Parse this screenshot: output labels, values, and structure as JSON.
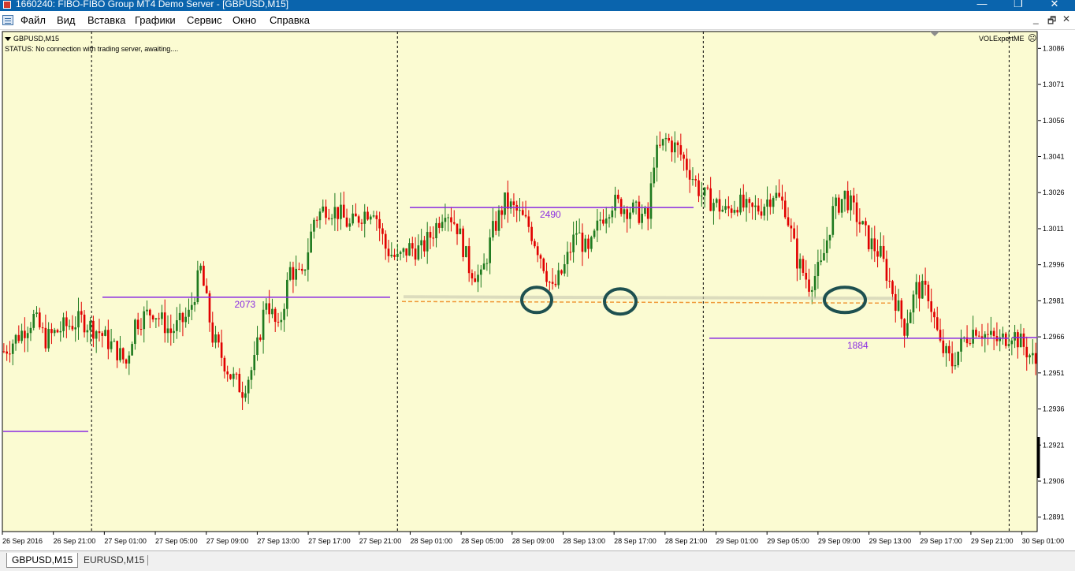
{
  "window": {
    "title": "1660240: FIBO-FIBO Group MT4 Demo Server - [GBPUSD,M15]",
    "controls": {
      "minimize": "—",
      "maximize": "❐",
      "close": "✕"
    }
  },
  "menu": {
    "items": [
      "Файл",
      "Вид",
      "Вставка",
      "Графики",
      "Сервис",
      "Окно",
      "Справка"
    ],
    "mdi": {
      "minimize": "_",
      "restore": "🗗",
      "close": "✕"
    }
  },
  "chart": {
    "symbol_label": "GBPUSD,M15",
    "status_text": "STATUS:    No connection with trading server, awaiting....",
    "expert_label": "VOLExpertME",
    "expert_icon": "smiley-face-icon",
    "colors": {
      "background": "#fbfbd2",
      "bull": "#1f7a1f",
      "bear": "#e10000",
      "level_line": "#8a2be2",
      "support_line": "#f09a3a",
      "marker": "#1e5050"
    }
  },
  "levels": [
    {
      "label": "2073",
      "price": 1.29825
    },
    {
      "label": "2490",
      "price": 1.30198
    },
    {
      "label": "1884",
      "price": 1.29654
    }
  ],
  "chart_data": {
    "type": "candlestick",
    "symbol": "GBPUSD",
    "timeframe": "M15",
    "y_ticks": [
      "1.3086",
      "1.3071",
      "1.3056",
      "1.3041",
      "1.3026",
      "1.3011",
      "1.2996",
      "1.2981",
      "1.2966",
      "1.2951",
      "1.2936",
      "1.2921",
      "1.2906",
      "1.2891"
    ],
    "ylim": [
      1.2885,
      1.3093
    ],
    "x_ticks": [
      "26 Sep 2016",
      "26 Sep 21:00",
      "27 Sep 01:00",
      "27 Sep 05:00",
      "27 Sep 09:00",
      "27 Sep 13:00",
      "27 Sep 17:00",
      "27 Sep 21:00",
      "28 Sep 01:00",
      "28 Sep 05:00",
      "28 Sep 09:00",
      "28 Sep 13:00",
      "28 Sep 17:00",
      "28 Sep 21:00",
      "29 Sep 01:00",
      "29 Sep 05:00",
      "29 Sep 09:00",
      "29 Sep 13:00",
      "29 Sep 17:00",
      "29 Sep 21:00",
      "30 Sep 01:00"
    ],
    "period_separators": [
      "27 Sep 2016",
      "28 Sep 2016",
      "29 Sep 2016",
      "30 Sep 2016"
    ],
    "support_level": 1.29807,
    "price_path": [
      [
        0,
        1.296
      ],
      [
        6,
        1.2968
      ],
      [
        10,
        1.2974
      ],
      [
        14,
        1.2965
      ],
      [
        20,
        1.297
      ],
      [
        26,
        1.2973
      ],
      [
        32,
        1.2968
      ],
      [
        38,
        1.296
      ],
      [
        41,
        1.2955
      ],
      [
        44,
        1.2972
      ],
      [
        50,
        1.2977
      ],
      [
        56,
        1.2968
      ],
      [
        62,
        1.2975
      ],
      [
        66,
        1.2994
      ],
      [
        70,
        1.2966
      ],
      [
        76,
        1.295
      ],
      [
        80,
        1.2944
      ],
      [
        84,
        1.2955
      ],
      [
        88,
        1.2982
      ],
      [
        92,
        1.2968
      ],
      [
        96,
        1.2994
      ],
      [
        100,
        1.299
      ],
      [
        104,
        1.3015
      ],
      [
        108,
        1.302
      ],
      [
        112,
        1.3018
      ],
      [
        116,
        1.3012
      ],
      [
        120,
        1.3017
      ],
      [
        124,
        1.302
      ],
      [
        128,
        1.3003
      ],
      [
        132,
        1.2998
      ],
      [
        136,
        1.3003
      ],
      [
        140,
        1.3002
      ],
      [
        144,
        1.301
      ],
      [
        148,
        1.302
      ],
      [
        152,
        1.3012
      ],
      [
        156,
        1.2995
      ],
      [
        160,
        1.299
      ],
      [
        164,
        1.301
      ],
      [
        168,
        1.3022
      ],
      [
        172,
        1.3018
      ],
      [
        176,
        1.3012
      ],
      [
        180,
        1.3
      ],
      [
        184,
        1.2985
      ],
      [
        188,
        1.2995
      ],
      [
        192,
        1.301
      ],
      [
        196,
        1.3
      ],
      [
        200,
        1.3015
      ],
      [
        204,
        1.3022
      ],
      [
        208,
        1.302
      ],
      [
        212,
        1.3018
      ],
      [
        216,
        1.3015
      ],
      [
        218,
        1.304
      ],
      [
        222,
        1.3048
      ],
      [
        226,
        1.3044
      ],
      [
        230,
        1.3035
      ],
      [
        234,
        1.3025
      ],
      [
        238,
        1.3022
      ],
      [
        242,
        1.3018
      ],
      [
        246,
        1.3022
      ],
      [
        250,
        1.3018
      ],
      [
        254,
        1.302
      ],
      [
        258,
        1.3026
      ],
      [
        262,
        1.302
      ],
      [
        266,
        1.2998
      ],
      [
        270,
        1.2988
      ],
      [
        274,
        1.2995
      ],
      [
        278,
        1.3018
      ],
      [
        282,
        1.3025
      ],
      [
        286,
        1.3016
      ],
      [
        290,
        1.3006
      ],
      [
        294,
        1.3
      ],
      [
        298,
        1.2985
      ],
      [
        302,
        1.297
      ],
      [
        306,
        1.2986
      ],
      [
        310,
        1.2984
      ],
      [
        314,
        1.2962
      ],
      [
        318,
        1.2955
      ],
      [
        322,
        1.2965
      ],
      [
        326,
        1.297
      ],
      [
        330,
        1.2966
      ],
      [
        334,
        1.2964
      ],
      [
        338,
        1.2968
      ],
      [
        342,
        1.2962
      ],
      [
        346,
        1.2955
      ]
    ]
  },
  "tabs": [
    {
      "label": "GBPUSD,M15",
      "active": true
    },
    {
      "label": "EURUSD,M15",
      "active": false
    }
  ]
}
